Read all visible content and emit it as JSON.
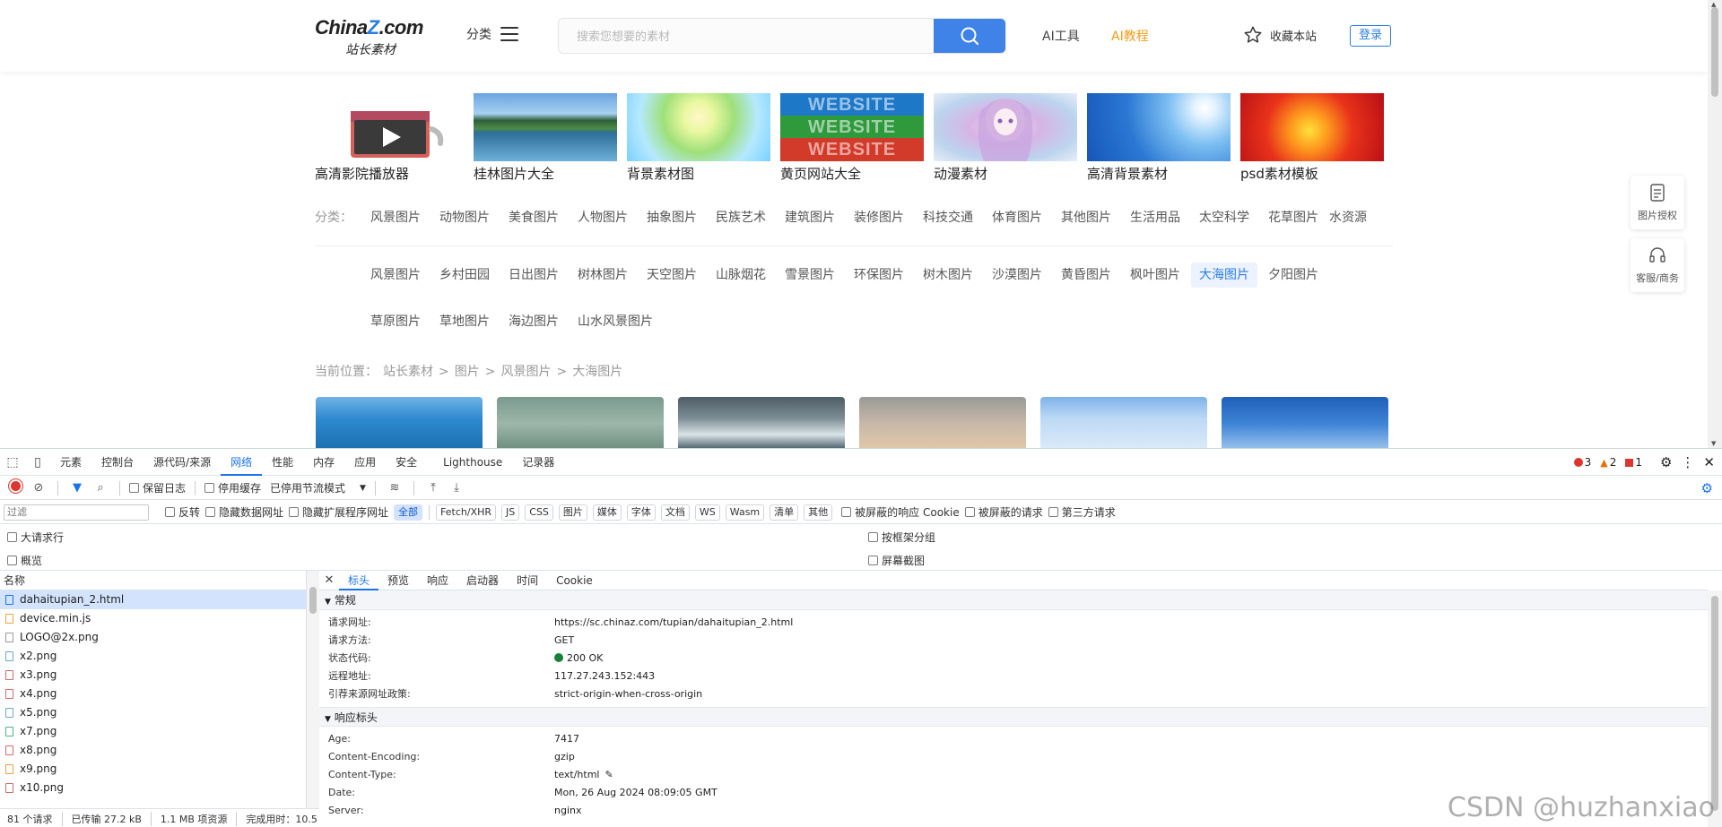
{
  "site": {
    "logo": {
      "main": "China",
      "accent": "Z",
      "suffix": ".com",
      "sub": "站长素材"
    },
    "category_label": "分类",
    "search": {
      "placeholder": "搜索您想要的素材"
    },
    "nav": {
      "ai_tools": "AI工具",
      "ai_tutorial": "AI教程"
    },
    "favorite_label": "收藏本站",
    "login_label": "登录",
    "features": [
      {
        "caption": "高清影院播放器"
      },
      {
        "caption": "桂林图片大全"
      },
      {
        "caption": "背景素材图"
      },
      {
        "caption": "黄页网站大全",
        "image_text": [
          "WEBSITE",
          "WEBSITE",
          "WEBSITE"
        ]
      },
      {
        "caption": "动漫素材"
      },
      {
        "caption": "高清背景素材"
      },
      {
        "caption": "psd素材模板"
      }
    ],
    "category_row": {
      "label": "分类：",
      "items": [
        "风景图片",
        "动物图片",
        "美食图片",
        "人物图片",
        "抽象图片",
        "民族艺术",
        "建筑图片",
        "装修图片",
        "科技交通",
        "体育图片",
        "其他图片",
        "生活用品",
        "太空科学",
        "花草图片",
        "水资源"
      ]
    },
    "sub_tags": [
      "风景图片",
      "乡村田园",
      "日出图片",
      "树林图片",
      "天空图片",
      "山脉烟花",
      "雪景图片",
      "环保图片",
      "树木图片",
      "沙漠图片",
      "黄昏图片",
      "枫叶图片",
      "大海图片",
      "夕阳图片",
      "草原图片",
      "草地图片",
      "海边图片",
      "山水风景图片"
    ],
    "active_tag": "大海图片",
    "breadcrumb": [
      "当前位置：",
      "站长素材",
      ">",
      "图片",
      ">",
      "风景图片",
      ">",
      "大海图片"
    ],
    "side_buttons": [
      {
        "label": "图片授权"
      },
      {
        "label": "客服/商务"
      }
    ]
  },
  "devtools": {
    "tabs": [
      "元素",
      "控制台",
      "源代码/来源",
      "网络",
      "性能",
      "内存",
      "应用",
      "安全",
      "Lighthouse",
      "记录器"
    ],
    "active_tab": "网络",
    "counts": {
      "errors": "3",
      "warnings": "2",
      "issues": "1"
    },
    "network_toolbar": {
      "preserve_log": "保留日志",
      "disable_cache": "停用缓存",
      "throttle": "已停用节流模式"
    },
    "filter": {
      "placeholder": "过滤",
      "invert": "反转",
      "hide_data_urls": "隐藏数据网址",
      "hide_ext_urls": "隐藏扩展程序网址",
      "types": [
        "全部",
        "Fetch/XHR",
        "JS",
        "CSS",
        "图片",
        "媒体",
        "字体",
        "文档",
        "WS",
        "Wasm",
        "清单",
        "其他"
      ],
      "blocked_cookies": "被屏蔽的响应 Cookie",
      "blocked_requests": "被屏蔽的请求",
      "third_party": "第三方请求"
    },
    "options": {
      "big_rows": "大请求行",
      "overview": "概览",
      "group_by_frame": "按框架分组",
      "screenshots": "屏幕截图"
    },
    "request_list": {
      "header": "名称",
      "items": [
        "dahaitupian_2.html",
        "device.min.js",
        "LOGO@2x.png",
        "x2.png",
        "x3.png",
        "x4.png",
        "x5.png",
        "x7.png",
        "x8.png",
        "x9.png",
        "x10.png"
      ],
      "selected": "dahaitupian_2.html"
    },
    "status_bar": [
      "81 个请求",
      "已传输 27.2 kB",
      "1.1 MB 项资源",
      "完成用时：10.5"
    ],
    "detail": {
      "tabs": [
        "标头",
        "预览",
        "响应",
        "启动器",
        "时间",
        "Cookie"
      ],
      "active": "标头",
      "general_title": "常规",
      "general": [
        {
          "k": "请求网址:",
          "v": "https://sc.chinaz.com/tupian/dahaitupian_2.html"
        },
        {
          "k": "请求方法:",
          "v": "GET"
        },
        {
          "k": "状态代码:",
          "v": "200 OK"
        },
        {
          "k": "远程地址:",
          "v": "117.27.243.152:443"
        },
        {
          "k": "引荐来源网址政策:",
          "v": "strict-origin-when-cross-origin"
        }
      ],
      "response_title": "响应标头",
      "response": [
        {
          "k": "Age:",
          "v": "7417"
        },
        {
          "k": "Content-Encoding:",
          "v": "gzip"
        },
        {
          "k": "Content-Type:",
          "v": "text/html"
        },
        {
          "k": "Date:",
          "v": "Mon, 26 Aug 2024 08:09:05 GMT"
        },
        {
          "k": "Server:",
          "v": "nginx"
        }
      ]
    }
  },
  "watermark": "CSDN @huzhanxiao"
}
